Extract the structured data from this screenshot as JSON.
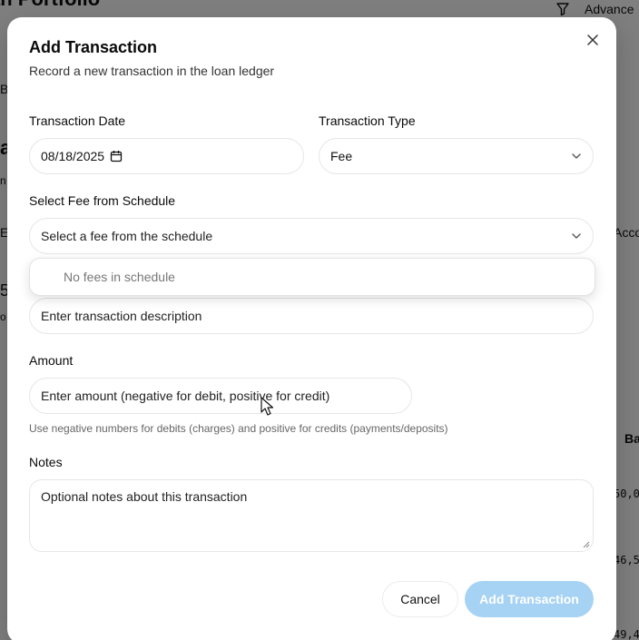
{
  "background": {
    "title_fragment": "an Portfolio",
    "advanced_fragment": "Advance",
    "filter_icon": "filter-icon",
    "left_fragments": [
      "B",
      "a",
      "n",
      "E",
      "5",
      "o"
    ],
    "right_fragments": [
      "Acco",
      "Ba"
    ],
    "mono_values": [
      "50,0",
      "46,5",
      "49,4"
    ]
  },
  "modal": {
    "title": "Add Transaction",
    "subtitle": "Record a new transaction in the loan ledger",
    "close_icon": "close-icon",
    "date": {
      "label": "Transaction Date",
      "value": "08/18/2025",
      "icon": "calendar-icon"
    },
    "type": {
      "label": "Transaction Type",
      "value": "Fee",
      "icon": "chevron-down-icon"
    },
    "fee": {
      "label": "Select Fee from Schedule",
      "placeholder": "Select a fee from the schedule",
      "icon": "chevron-down-icon",
      "empty_message": "No fees in schedule"
    },
    "description": {
      "placeholder": "Enter transaction description"
    },
    "amount": {
      "label": "Amount",
      "placeholder": "Enter amount (negative for debit, positive for credit)",
      "helper": "Use negative numbers for debits (charges) and positive for credits (payments/deposits)"
    },
    "notes": {
      "label": "Notes",
      "placeholder": "Optional notes about this transaction"
    },
    "buttons": {
      "cancel": "Cancel",
      "submit": "Add Transaction"
    },
    "colors": {
      "submit_disabled": "#a6d2f4",
      "overlay": "rgba(0,0,0,0.5)"
    }
  }
}
